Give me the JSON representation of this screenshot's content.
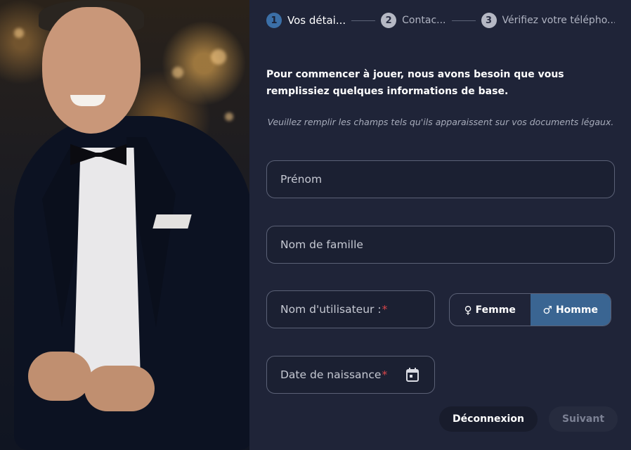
{
  "steps": [
    {
      "number": "1",
      "label": "Vos détai...",
      "state": "active"
    },
    {
      "number": "2",
      "label": "Contac...",
      "state": "inactive"
    },
    {
      "number": "3",
      "label": "Vérifiez votre télépho...",
      "state": "inactive"
    }
  ],
  "intro": "Pour commencer à jouer, nous avons besoin que vous remplissiez quelques informations de base.",
  "hint": "Veuillez remplir les champs tels qu'ils apparaissent sur vos documents légaux.",
  "fields": {
    "first_name": {
      "placeholder": "Prénom"
    },
    "last_name": {
      "placeholder": "Nom de famille"
    },
    "username": {
      "placeholder": "Nom d'utilisateur :",
      "required_mark": "*"
    },
    "birthdate": {
      "placeholder": "Date de naissance",
      "required_mark": "*",
      "icon": "calendar-icon"
    }
  },
  "gender": {
    "female": {
      "label": "Femme",
      "icon": "female-symbol-icon"
    },
    "male": {
      "label": "Homme",
      "icon": "male-symbol-icon",
      "selected": true
    }
  },
  "actions": {
    "logout": "Déconnexion",
    "next": "Suivant"
  },
  "colors": {
    "panel_bg": "#1f2438",
    "accent": "#3b6fa7",
    "selected_gender": "#3a6592",
    "required": "#d8454a"
  }
}
